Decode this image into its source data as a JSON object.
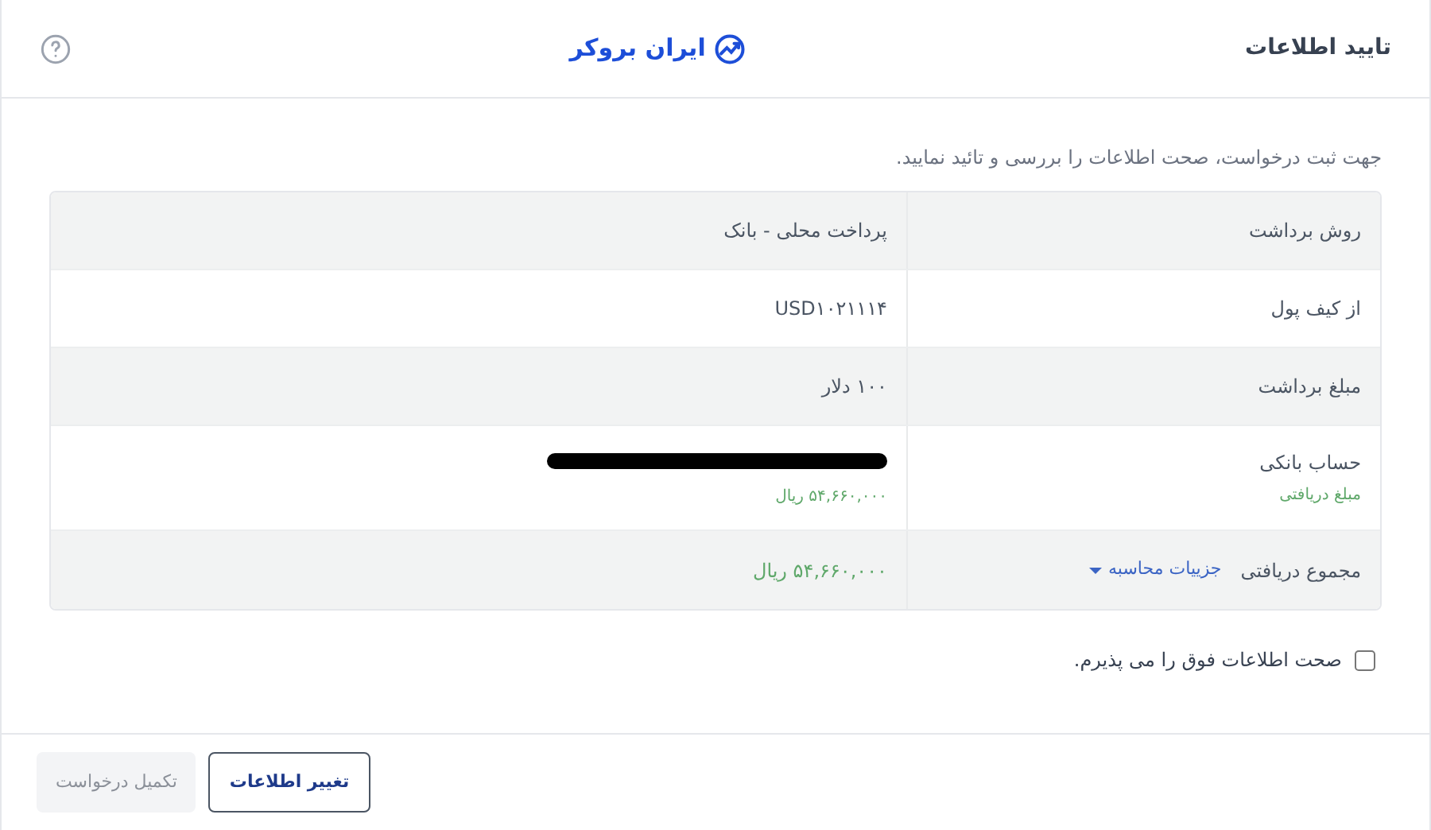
{
  "header": {
    "title": "تایید اطلاعات",
    "logo": "ایران بروکر"
  },
  "intro": "جهت ثبت درخواست، صحت اطلاعات را بررسی و تائید نمایید.",
  "rows": [
    {
      "kind": "text",
      "label": "روش برداشت",
      "value": "پرداخت محلی - بانک"
    },
    {
      "kind": "text",
      "label": "از کیف پول",
      "value": "USD۱۰۲۱۱۱۴"
    },
    {
      "kind": "text",
      "label": "مبلغ برداشت",
      "value": "۱۰۰ دلار"
    },
    {
      "kind": "account",
      "label": "حساب بانکی",
      "sublabel": "مبلغ دریافتی",
      "subvalue": "۵۴,۶۶۰,۰۰۰ ریال"
    },
    {
      "kind": "total",
      "label": "مجموع دریافتی",
      "link": "جزییات محاسبه",
      "value": "۵۴,۶۶۰,۰۰۰ ریال"
    }
  ],
  "agree": {
    "label": "صحت اطلاعات فوق را می پذیرم.",
    "checked": false
  },
  "buttons": [
    {
      "label": "تغییر اطلاعات",
      "disabled": false
    },
    {
      "label": "تکمیل درخواست",
      "disabled": true
    }
  ]
}
